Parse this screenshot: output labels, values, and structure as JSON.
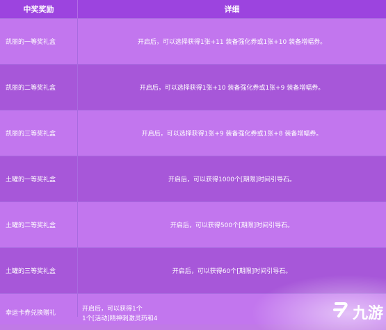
{
  "header": {
    "col1": "中奖奖励",
    "col2": "详细"
  },
  "rows": [
    {
      "name": "凯丽的一等奖礼盒",
      "detail": "开启后，可以选择获得1张+11 装备强化券或1张+10 装备增幅券。"
    },
    {
      "name": "凯丽的二等奖礼盒",
      "detail": "开启后，可以选择获得1张+10 装备强化券或1张+9 装备增幅券。"
    },
    {
      "name": "凯丽的三等奖礼盒",
      "detail": "开启后，可以选择获得1张+9 装备强化券或1张+8 装备增幅券。"
    },
    {
      "name": "土罐的一等奖礼盒",
      "detail": "开启后，可以获得1000个[期限]时间引导石。"
    },
    {
      "name": "土罐的二等奖礼盒",
      "detail": "开启后，可以获得500个[期限]时间引导石。"
    },
    {
      "name": "土罐的三等奖礼盒",
      "detail": "开启后，可以获得60个[期限]时间引导石。"
    },
    {
      "name": "幸运卡券兑换赠礼",
      "detail_line1": "开启后，可以获得1个",
      "detail_line2": "1个[活动]精神刺激灵药和4"
    }
  ],
  "watermark": {
    "text": "九游"
  }
}
